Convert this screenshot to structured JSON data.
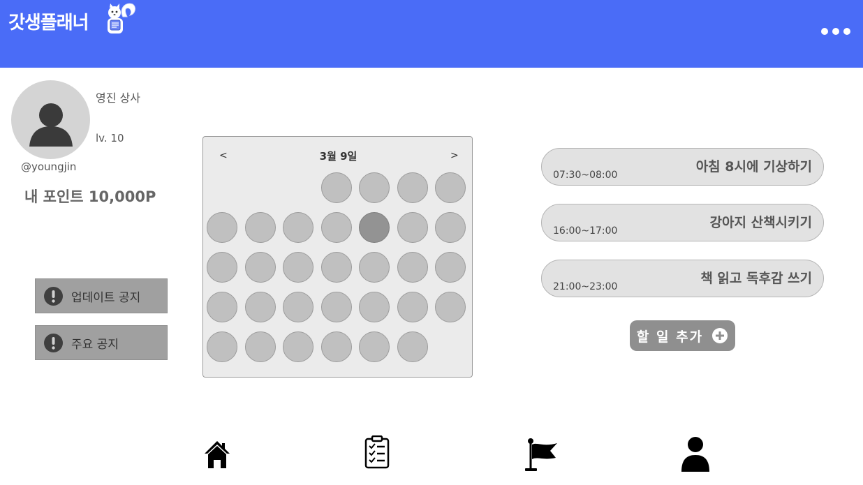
{
  "header": {
    "app_title": "갓생플래너",
    "mascot_icon": "squirrel-mascot-icon",
    "menu_icon": "more-horizontal-icon",
    "color": "#4a6cf7"
  },
  "profile": {
    "name": "영진 상사",
    "level": "lv. 10",
    "handle": "@youngjin",
    "points": "내 포인트 10,000P",
    "avatar_icon": "person-icon"
  },
  "notices": [
    {
      "label": "업데이트 공지",
      "icon": "exclamation-icon"
    },
    {
      "label": "주요 공지",
      "icon": "exclamation-icon"
    }
  ],
  "calendar": {
    "title": "3월 9일",
    "prev": "<",
    "next": ">",
    "first_weekday": 3,
    "days": 31,
    "selected_day": 9
  },
  "tasks": [
    {
      "name": "아침 8시에 기상하기",
      "time": "07:30~08:00"
    },
    {
      "name": "강아지 산책시키기",
      "time": "16:00~17:00"
    },
    {
      "name": "책 읽고 독후감 쓰기",
      "time": "21:00~23:00"
    }
  ],
  "add_task": {
    "label": "할 일 추가",
    "icon": "plus-circle-icon"
  },
  "bottom_nav": [
    {
      "name": "home",
      "icon": "home-icon"
    },
    {
      "name": "checklist",
      "icon": "clipboard-checklist-icon"
    },
    {
      "name": "goals",
      "icon": "flag-icon"
    },
    {
      "name": "profile",
      "icon": "person-icon"
    }
  ]
}
